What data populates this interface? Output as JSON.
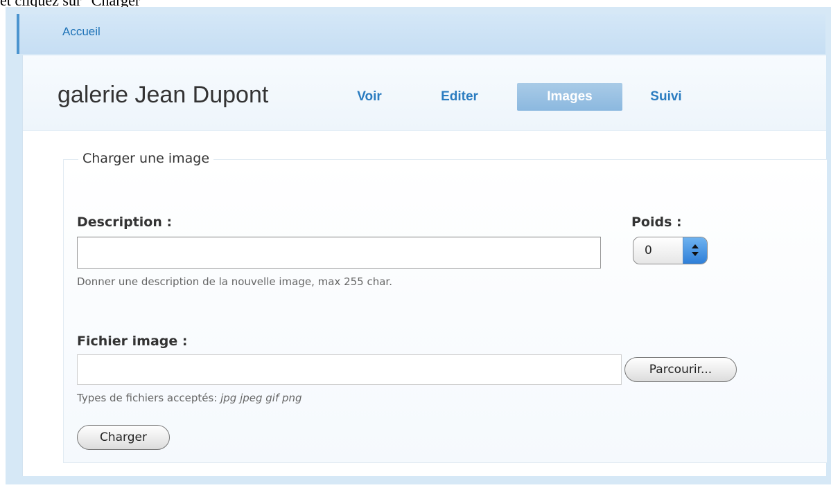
{
  "caption": "et cliquez sur \"Charger\"",
  "breadcrumb": {
    "home_label": "Accueil"
  },
  "page": {
    "title": "galerie Jean Dupont",
    "tabs": [
      {
        "label": "Voir",
        "active": false
      },
      {
        "label": "Editer",
        "active": false
      },
      {
        "label": "Images",
        "active": true
      },
      {
        "label": "Suivi",
        "active": false
      }
    ]
  },
  "upload_form": {
    "legend": "Charger une image",
    "description": {
      "label": "Description :",
      "value": "",
      "help": "Donner une description de la nouvelle image, max 255 char."
    },
    "weight": {
      "label": "Poids :",
      "selected": "0"
    },
    "file": {
      "label": "Fichier image :",
      "value": "",
      "browse_label": "Parcourir...",
      "help_prefix": "Types de fichiers acceptés: ",
      "help_types": "jpg jpeg gif png"
    },
    "submit_label": "Charger"
  },
  "colors": {
    "accent": "#2a7cc0",
    "active_tab": "#8bb8df",
    "frame": "#d6e8f6"
  }
}
